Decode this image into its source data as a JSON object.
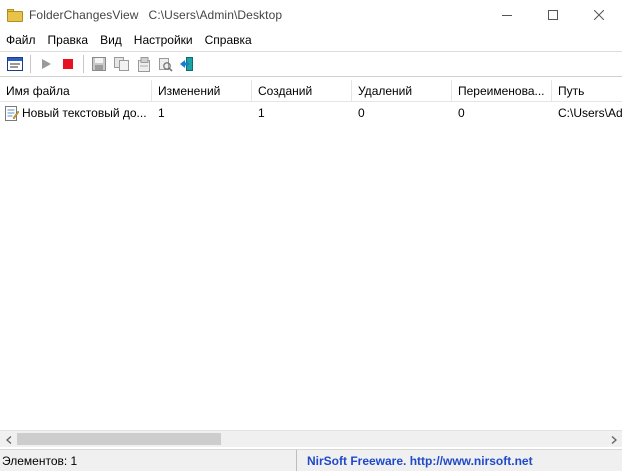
{
  "window": {
    "app_name": "FolderChangesView",
    "path": "C:\\Users\\Admin\\Desktop"
  },
  "menu": [
    "Файл",
    "Правка",
    "Вид",
    "Настройки",
    "Справка"
  ],
  "toolbar": {
    "icons": [
      "properties-icon",
      "start-icon",
      "stop-icon",
      "save-icon",
      "copy-icon",
      "html-report-icon",
      "find-icon",
      "exit-icon"
    ]
  },
  "table": {
    "columns": [
      "Имя файла",
      "Изменений",
      "Созданий",
      "Удалений",
      "Переименова...",
      "Путь"
    ],
    "rows": [
      [
        "Новый текстовый до...",
        "1",
        "1",
        "0",
        "0",
        "C:\\Users\\Ad"
      ]
    ]
  },
  "status": {
    "items_count": "Элементов: 1",
    "credit": "NirSoft Freeware.  http://www.nirsoft.net"
  },
  "colors": {
    "stop_red": "#e81123",
    "link_blue": "#1f49c9"
  }
}
